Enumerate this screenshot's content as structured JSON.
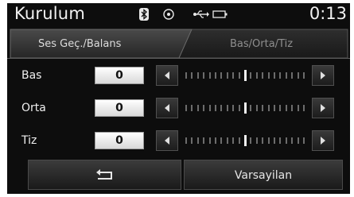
{
  "statusbar": {
    "title": "Kurulum",
    "clock": "0:13",
    "icons": [
      "bluetooth-icon",
      "navigation-icon",
      "usb-icon",
      "battery-icon"
    ]
  },
  "tabs": [
    {
      "label": "Ses Geç./Balans",
      "active": true
    },
    {
      "label": "Bas/Orta/Tiz",
      "active": false
    }
  ],
  "rows": [
    {
      "label": "Bas",
      "value": "0",
      "level": 0
    },
    {
      "label": "Orta",
      "value": "0",
      "level": 0
    },
    {
      "label": "Tiz",
      "value": "0",
      "level": 0
    }
  ],
  "bottom": {
    "back_icon": "return-arrow-icon",
    "default_label": "Varsayilan"
  },
  "colors": {
    "background": "#0d0d0d",
    "text": "#efefef",
    "value_box": "#e6e6e6"
  }
}
